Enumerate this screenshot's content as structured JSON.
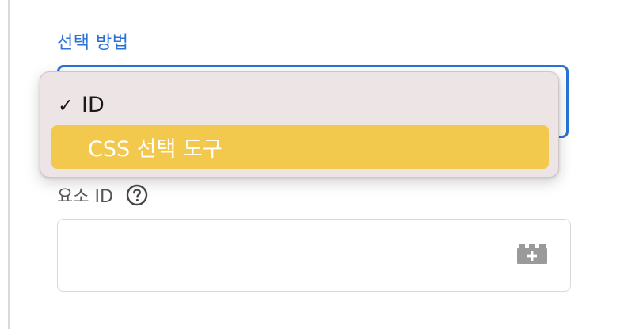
{
  "form": {
    "selection_method_label": "선택 방법",
    "element_id_label": "요소 ID",
    "element_id_value": "",
    "element_id_placeholder": ""
  },
  "dropdown": {
    "options": [
      {
        "label": "ID",
        "checked": true,
        "highlighted": false
      },
      {
        "label": "CSS 선택 도구",
        "checked": false,
        "highlighted": true
      }
    ]
  },
  "icons": {
    "check": "checkmark-icon",
    "help": "question-circle-icon",
    "picker": "element-picker-add-icon"
  },
  "colors": {
    "accent": "#2a73d6",
    "highlight": "#f2c94c",
    "dropdown_bg": "#ede5e5"
  }
}
